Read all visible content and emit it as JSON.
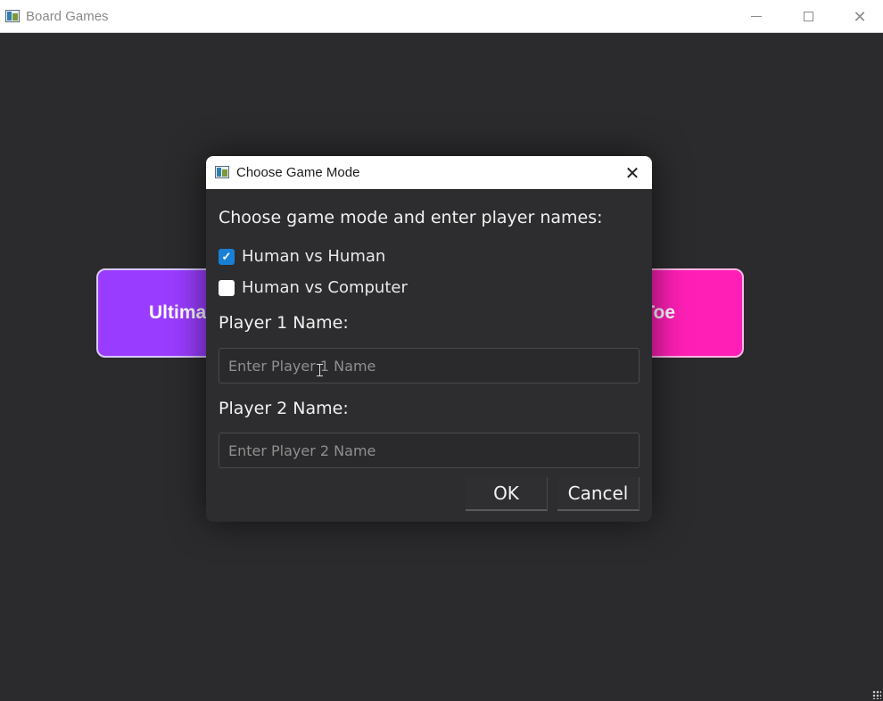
{
  "window": {
    "title": "Board Games",
    "controls": [
      "minimize-icon",
      "maximize-icon",
      "close-icon"
    ]
  },
  "main": {
    "buttons": [
      {
        "label": "Ultima",
        "color": "#9a3cff"
      },
      {
        "label": "Toe",
        "color": "#ff1fb6"
      }
    ]
  },
  "dialog": {
    "title": "Choose Game Mode",
    "prompt": "Choose game mode and enter player names:",
    "options": [
      {
        "label": "Human vs Human",
        "checked": true
      },
      {
        "label": "Human vs Computer",
        "checked": false
      }
    ],
    "player1": {
      "label": "Player 1 Name:",
      "placeholder": "Enter Player 1 Name",
      "value": ""
    },
    "player2": {
      "label": "Player 2 Name:",
      "placeholder": "Enter Player 2 Name",
      "value": ""
    },
    "ok_label": "OK",
    "cancel_label": "Cancel",
    "accent": "#1a7fd6"
  }
}
